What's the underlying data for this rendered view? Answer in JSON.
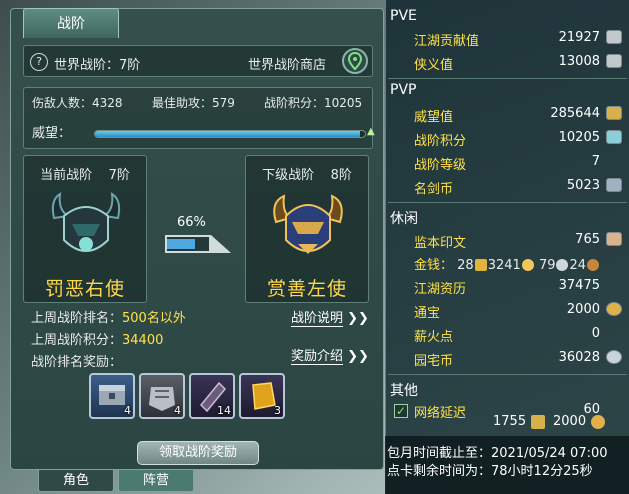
{
  "left": {
    "tab_title": "战阶",
    "world_rank": "世界战阶：7阶",
    "world_shop": "世界战阶商店",
    "stats": {
      "kills": "伤敌人数：4328",
      "assists": "最佳助攻：579",
      "points": "战阶积分：10205"
    },
    "prestige_label": "威望：",
    "prestige_progress": 0.98,
    "current_rank": {
      "caption": "当前战阶",
      "level": "7阶",
      "title": "罚恶右使"
    },
    "next_rank": {
      "caption": "下级战阶",
      "level": "8阶",
      "title": "赏善左使"
    },
    "progress_text": "66%",
    "progress_value": 0.66,
    "last_week_rank_label": "上周战阶排名：",
    "last_week_rank_value": "500名以外",
    "last_week_points_label": "上周战阶积分：",
    "last_week_points_value": "34400",
    "reward_label": "战阶排名奖励：",
    "rank_info_link": "战阶说明",
    "reward_info_link": "奖励介绍",
    "link_chevron": "❯❯",
    "reward_items": [
      {
        "icon": "treasure-chest-icon",
        "count": "4"
      },
      {
        "icon": "armor-icon",
        "count": "4"
      },
      {
        "icon": "scroll-icon",
        "count": "14"
      },
      {
        "icon": "gold-ingot-icon",
        "count": "3"
      }
    ],
    "claim_button": "领取战阶奖励",
    "bottom_tabs": [
      "角色",
      "阵营"
    ]
  },
  "right": {
    "pve_title": "PVE",
    "pve_rows": [
      {
        "label": "江湖贡献值",
        "value": "21927"
      },
      {
        "label": "侠义值",
        "value": "13008"
      }
    ],
    "pvp_title": "PVP",
    "pvp_rows": [
      {
        "label": "威望值",
        "value": "285644"
      },
      {
        "label": "战阶积分",
        "value": "10205"
      },
      {
        "label": "战阶等级",
        "value": "7"
      },
      {
        "label": "名剑币",
        "value": "5023"
      }
    ],
    "leisure_title": "休闲",
    "leisure_rows": [
      {
        "label": "监本印文",
        "value": "765"
      },
      {
        "label": "江湖资历",
        "value": "37475"
      },
      {
        "label": "通宝",
        "value": "2000"
      },
      {
        "label": "薪火点",
        "value": "0"
      },
      {
        "label": "园宅币",
        "value": "36028"
      }
    ],
    "money_label": "金钱：",
    "money": {
      "brick": "28",
      "gold": "3241",
      "silver": "79",
      "copper": "24"
    },
    "other_title": "其他",
    "other_row_label": "网络延迟",
    "other_row_value": "60",
    "footer_values": {
      "a": "1755",
      "b": "2000"
    },
    "monthly_time": "包月时间截止至：2021/05/24 07:00",
    "point_time": "点卡剩余时间为：78小时12分25秒"
  },
  "colors": {
    "gold_text": "#ffe14a",
    "panel_bg": "#2b4542",
    "bar_blue": "#2a8fc0"
  }
}
